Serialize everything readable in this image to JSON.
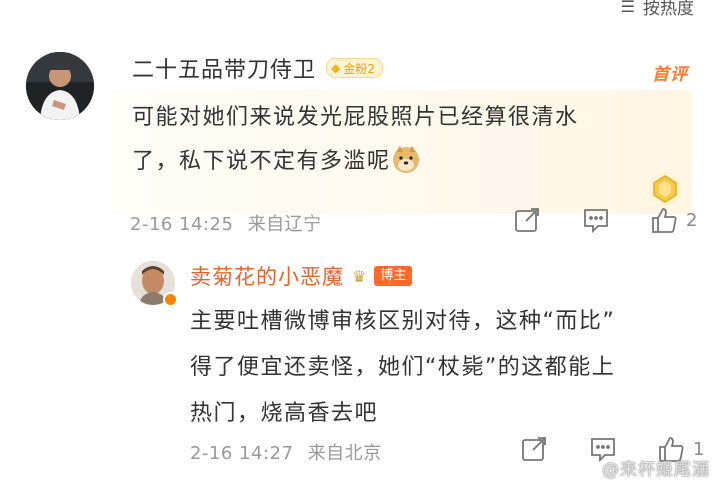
{
  "sort": {
    "label": "按热度",
    "icon": "sort-lines-icon"
  },
  "comments": [
    {
      "user": "二十五品带刀侍卫",
      "fan_badge": "金粉2",
      "first_badge": "首评",
      "text_line1": "可能对她们来说发光屁股照片已经算很清水",
      "text_line2": "了，私下说不定有多滥呢",
      "emoji": "doge-emoji-icon",
      "date": "2-16 14:25",
      "location": "来自辽宁",
      "likes": "2"
    }
  ],
  "reply": {
    "user": "卖菊花的小恶魔",
    "host_badge": "博主",
    "line1": "主要吐槽微博审核区别对待，这种“而比”",
    "line2": "得了便宜还卖怪，她们“杖毙”的这都能上",
    "line3": "热门，烧高香去吧",
    "date": "2-16 14:27",
    "location": "来自北京",
    "likes": "1"
  },
  "watermark": "@来杯姬尾酒",
  "colors": {
    "accent": "#ff8200",
    "host_badge": "#ff6a2b",
    "fan_badge": "#f5b31c",
    "reply_name": "#e8632e"
  }
}
